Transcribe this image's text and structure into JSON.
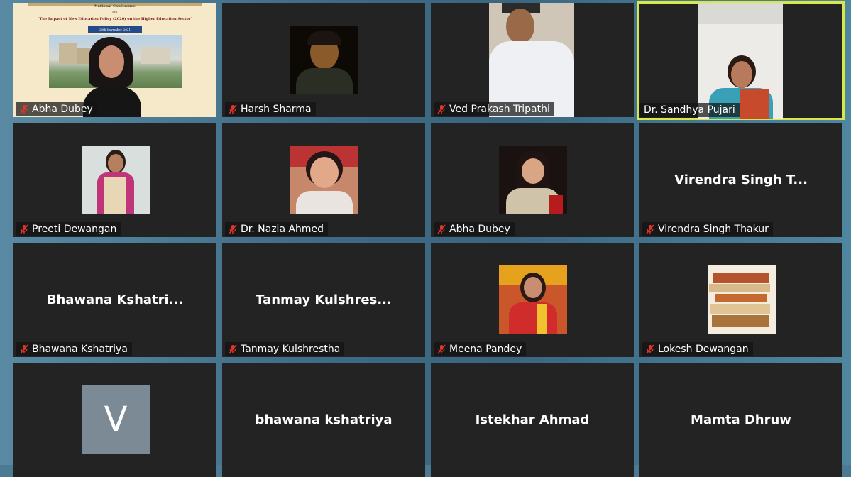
{
  "participants": [
    {
      "name": "Abha Dubey",
      "video": "slide"
    },
    {
      "name": "Harsh Sharma",
      "video": "photo"
    },
    {
      "name": "Ved Prakash Tripathi",
      "video": "photo"
    },
    {
      "name": "Dr. Sandhya Pujari",
      "video": "photo",
      "active": true
    },
    {
      "name": "Preeti Dewangan",
      "video": "photo"
    },
    {
      "name": "Dr. Nazia Ahmed",
      "video": "photo"
    },
    {
      "name": "Abha Dubey",
      "video": "photo"
    },
    {
      "name": "Virendra Singh Thakur",
      "video": "name",
      "display": "Virendra Singh T..."
    },
    {
      "name": "Bhawana Kshatriya",
      "video": "name",
      "display": "Bhawana Kshatri..."
    },
    {
      "name": "Tanmay Kulshrestha",
      "video": "name",
      "display": "Tanmay Kulshres..."
    },
    {
      "name": "Meena Pandey",
      "video": "photo"
    },
    {
      "name": "Lokesh Dewangan",
      "video": "photo"
    },
    {
      "name": "",
      "video": "avatar",
      "avatar_letter": "V"
    },
    {
      "name": "",
      "video": "name",
      "display": "bhawana kshatriya"
    },
    {
      "name": "",
      "video": "name",
      "display": "Istekhar Ahmad"
    },
    {
      "name": "",
      "video": "name",
      "display": "Mamta Dhruw"
    }
  ],
  "slide": {
    "line1": "National Conference",
    "line2": "On",
    "line3": "\"The Impact of New Education Policy (2020) on the Higher Education Sector\"",
    "date": "20th November, 2021"
  },
  "colors": {
    "active_border": "#d8e84a",
    "tile_bg": "#232323",
    "mic_off": "#e0352b"
  }
}
